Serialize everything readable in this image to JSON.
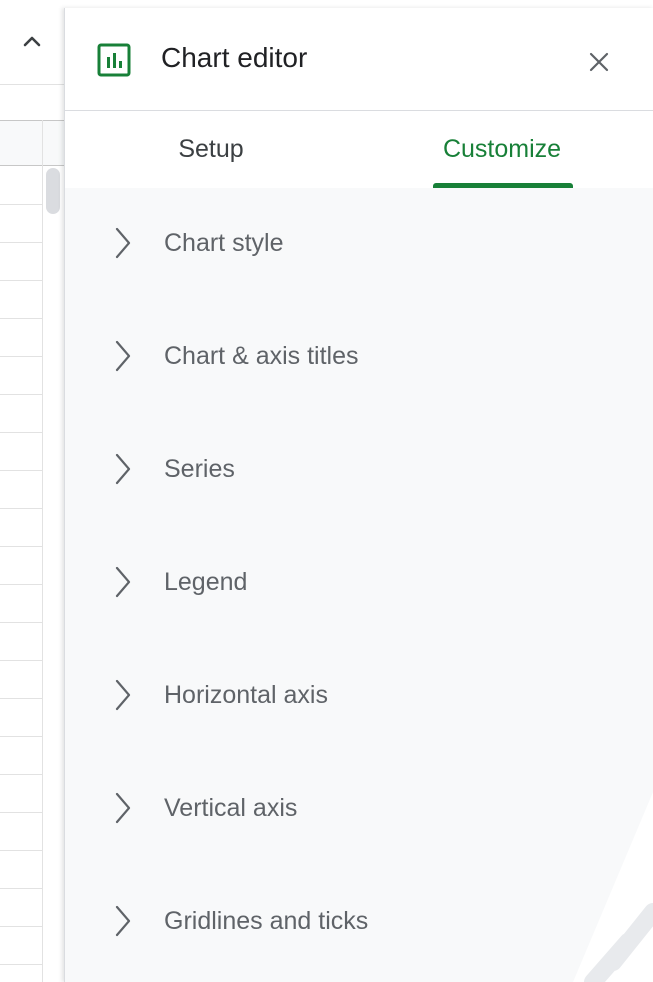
{
  "editor": {
    "title": "Chart editor",
    "icon": "chart-icon",
    "close_icon": "close-icon",
    "accent_color": "#188038"
  },
  "tabs": [
    {
      "label": "Setup",
      "active": false
    },
    {
      "label": "Customize",
      "active": true
    }
  ],
  "sections": [
    {
      "label": "Chart style",
      "expanded": false
    },
    {
      "label": "Chart & axis titles",
      "expanded": false
    },
    {
      "label": "Series",
      "expanded": false
    },
    {
      "label": "Legend",
      "expanded": false
    },
    {
      "label": "Horizontal axis",
      "expanded": false
    },
    {
      "label": "Vertical axis",
      "expanded": false
    },
    {
      "label": "Gridlines and ticks",
      "expanded": false
    }
  ],
  "sheet": {
    "collapse_icon": "chevron-up-icon"
  }
}
